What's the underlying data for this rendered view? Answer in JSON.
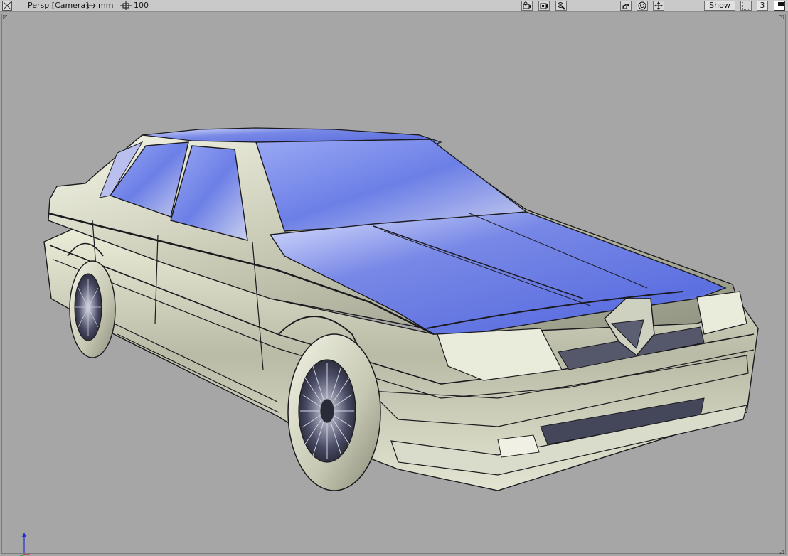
{
  "toolbar": {
    "view_label": "Persp [Camera]",
    "units_icon": "double-arrow-icon",
    "units_label": "mm",
    "grid_icon": "grid-crosshair-icon",
    "grid_value": "100",
    "buttons_left": [
      "camera-icon",
      "film-camera-icon",
      "zoom-icon"
    ],
    "buttons_right": [
      "tumble-icon",
      "sphere-icon",
      "move-arrows-icon"
    ],
    "show_label": "Show",
    "layout_number": "3"
  },
  "viewport": {
    "background_color": "#a6a6a6",
    "model": "car-model",
    "shading_colors": [
      "#5c6fe0",
      "#c9ccb8",
      "#eef0dc",
      "#1b1b1f"
    ]
  },
  "axis": {
    "x_color": "#d02020",
    "y_color": "#20a020",
    "z_color": "#2030d0"
  }
}
